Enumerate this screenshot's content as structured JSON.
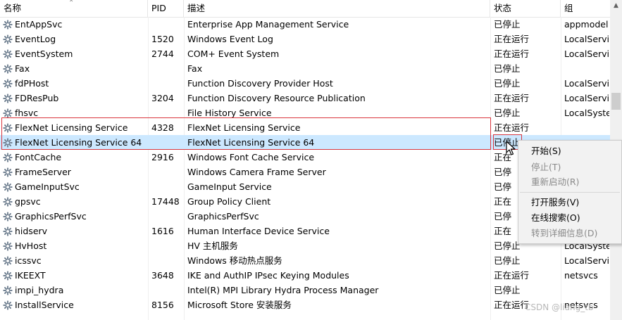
{
  "columns": {
    "name": "名称",
    "pid": "PID",
    "desc": "描述",
    "status": "状态",
    "group": "组"
  },
  "rows": [
    {
      "name": "EntAppSvc",
      "pid": "",
      "desc": "Enterprise App Management Service",
      "status": "已停止",
      "group": "appmodel"
    },
    {
      "name": "EventLog",
      "pid": "1520",
      "desc": "Windows Event Log",
      "status": "正在运行",
      "group": "LocalServic"
    },
    {
      "name": "EventSystem",
      "pid": "2744",
      "desc": "COM+ Event System",
      "status": "正在运行",
      "group": "LocalServic"
    },
    {
      "name": "Fax",
      "pid": "",
      "desc": "Fax",
      "status": "已停止",
      "group": ""
    },
    {
      "name": "fdPHost",
      "pid": "",
      "desc": "Function Discovery Provider Host",
      "status": "已停止",
      "group": "LocalServic"
    },
    {
      "name": "FDResPub",
      "pid": "3204",
      "desc": "Function Discovery Resource Publication",
      "status": "正在运行",
      "group": "LocalServic"
    },
    {
      "name": "fhsvc",
      "pid": "",
      "desc": "File History Service",
      "status": "已停止",
      "group": "LocalSyster"
    },
    {
      "name": "FlexNet Licensing Service",
      "pid": "4328",
      "desc": "FlexNet Licensing Service",
      "status": "正在运行",
      "group": ""
    },
    {
      "name": "FlexNet Licensing Service 64",
      "pid": "",
      "desc": "FlexNet Licensing Service 64",
      "status": "已停止",
      "group": ""
    },
    {
      "name": "FontCache",
      "pid": "2916",
      "desc": "Windows Font Cache Service",
      "status": "正在",
      "group": ""
    },
    {
      "name": "FrameServer",
      "pid": "",
      "desc": "Windows Camera Frame Server",
      "status": "已停",
      "group": ""
    },
    {
      "name": "GameInputSvc",
      "pid": "",
      "desc": "GameInput Service",
      "status": "已停",
      "group": ""
    },
    {
      "name": "gpsvc",
      "pid": "17448",
      "desc": "Group Policy Client",
      "status": "正在",
      "group": ""
    },
    {
      "name": "GraphicsPerfSvc",
      "pid": "",
      "desc": "GraphicsPerfSvc",
      "status": "已停",
      "group": ""
    },
    {
      "name": "hidserv",
      "pid": "1616",
      "desc": "Human Interface Device Service",
      "status": "正在",
      "group": ""
    },
    {
      "name": "HvHost",
      "pid": "",
      "desc": "HV 主机服务",
      "status": "已停止",
      "group": "LocalSyster"
    },
    {
      "name": "icssvc",
      "pid": "",
      "desc": "Windows 移动热点服务",
      "status": "已停止",
      "group": "LocalServic"
    },
    {
      "name": "IKEEXT",
      "pid": "3648",
      "desc": "IKE and AuthIP IPsec Keying Modules",
      "status": "正在运行",
      "group": "netsvcs"
    },
    {
      "name": "impi_hydra",
      "pid": "",
      "desc": "Intel(R) MPI Library Hydra Process Manager",
      "status": "已停止",
      "group": ""
    },
    {
      "name": "InstallService",
      "pid": "8156",
      "desc": "Microsoft Store 安装服务",
      "status": "正在运行",
      "group": "netsvcs"
    }
  ],
  "selected_row_index": 8,
  "context_menu": {
    "items": [
      {
        "label": "开始(S)",
        "enabled": true
      },
      {
        "label": "停止(T)",
        "enabled": false
      },
      {
        "label": "重新启动(R)",
        "enabled": false
      },
      {
        "label": "打开服务(V)",
        "enabled": true
      },
      {
        "label": "在线搜索(O)",
        "enabled": true
      },
      {
        "label": "转到详细信息(D)",
        "enabled": false
      }
    ]
  },
  "watermark": "CSDN @liang_tb",
  "colors": {
    "selection": "#cce8ff",
    "highlight_box": "#d9363e",
    "disabled_text": "#8a8a8a"
  },
  "icons": {
    "service": "gear-icon",
    "sort": "sort-ascending-icon"
  }
}
